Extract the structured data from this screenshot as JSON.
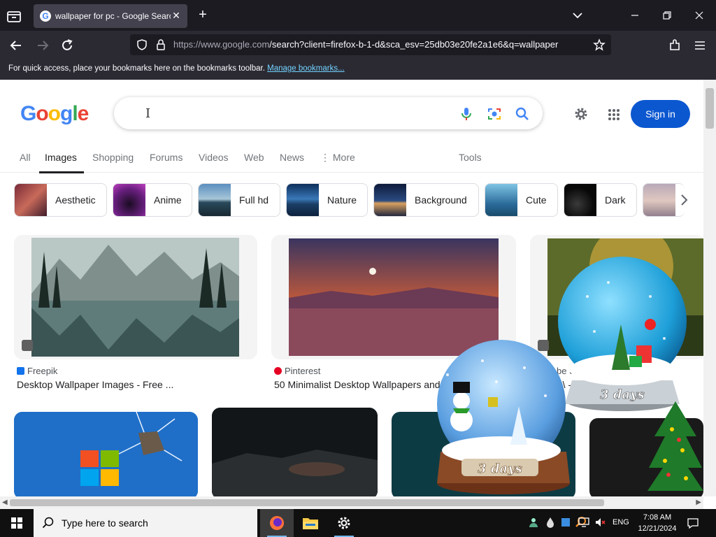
{
  "browser": {
    "tab_title": "wallpaper for pc - Google Search",
    "tab_close": "✕",
    "new_tab": "+",
    "url_host": "https://www.google.com",
    "url_rest": "/search?client=firefox-b-1-d&sca_esv=25db03e20fe2a1e6&q=wallpaper",
    "bookmarks_text": "For quick access, place your bookmarks here on the bookmarks toolbar.",
    "bookmarks_link": "Manage bookmarks..."
  },
  "google": {
    "sign_in": "Sign in",
    "tabs": [
      "All",
      "Images",
      "Shopping",
      "Forums",
      "Videos",
      "Web",
      "News",
      "⋮ More",
      "Tools"
    ],
    "active_tab": "Images",
    "chips": [
      "Aesthetic",
      "Anime",
      "Full hd",
      "Nature",
      "Background",
      "Cute",
      "Dark"
    ],
    "results": [
      {
        "source": "Freepik",
        "title": "Desktop Wallpaper Images - Free ..."
      },
      {
        "source": "Pinterest",
        "title": "50 Minimalist Desktop Wallpapers and"
      },
      {
        "source": "be S",
        "title": "p \\ - Brows"
      }
    ],
    "overlay_text": [
      "3 days",
      "3 days"
    ]
  },
  "taskbar": {
    "search_placeholder": "Type here to search",
    "lang": "ENG",
    "time": "7:08 AM",
    "date": "12/21/2024"
  }
}
